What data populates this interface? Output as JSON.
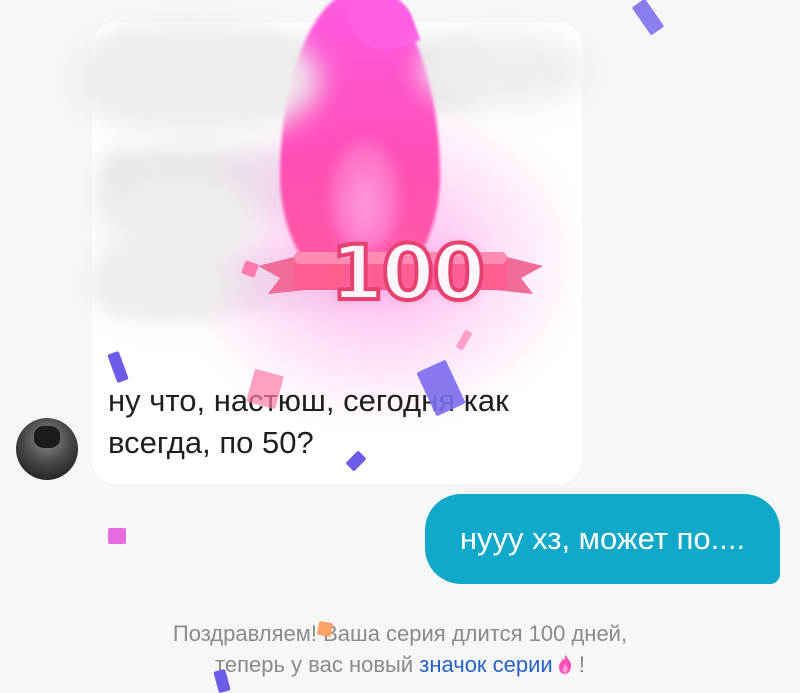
{
  "streak": {
    "days": "100",
    "colors": {
      "flame": "#ff4fb8",
      "ribbon": "#e6426f",
      "number_fill": "#fff6fb"
    }
  },
  "incoming_message": {
    "text_line1": "ну что, настюш, сегодня как",
    "text_line2": "всегда, по 50?",
    "avatar_icon": "profile-photo"
  },
  "outgoing_message": {
    "text": "нууу хз, может по....",
    "bubble_color": "#11a9c9"
  },
  "system_message": {
    "line1": "Поздравляем! Ваша серия длится 100 дней,",
    "line2_prefix": "теперь у вас новый ",
    "link_text": "значок серии",
    "suffix": " !",
    "icon": "fire-icon",
    "link_color": "#2563c7"
  }
}
